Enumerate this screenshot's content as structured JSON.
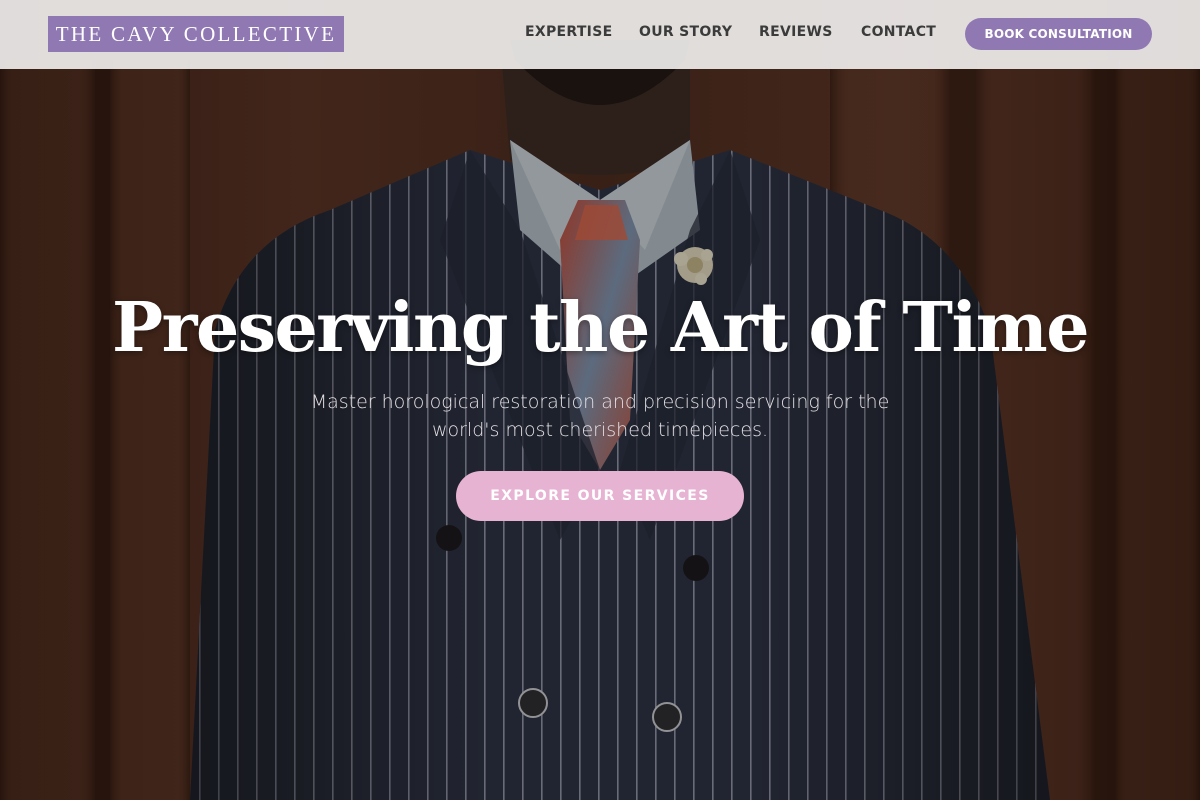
{
  "header": {
    "logo_text": "THE CAVY COLLECTIVE",
    "nav": [
      {
        "label": "EXPERTISE"
      },
      {
        "label": "OUR STORY"
      },
      {
        "label": "REVIEWS"
      },
      {
        "label": "CONTACT"
      }
    ],
    "cta_label": "BOOK CONSULTATION"
  },
  "hero": {
    "title": "Preserving the Art of Time",
    "subtitle": "Master horological restoration and precision servicing for the world's most cherished timepieces.",
    "button_label": "EXPLORE OUR SERVICES",
    "image": "man-in-pinstripe-suit-photo"
  },
  "colors": {
    "brand_purple": "#9079b3",
    "button_pink": "#e7b3d3",
    "header_bg": "#eeeceb",
    "nav_text": "#3b3b3b"
  }
}
